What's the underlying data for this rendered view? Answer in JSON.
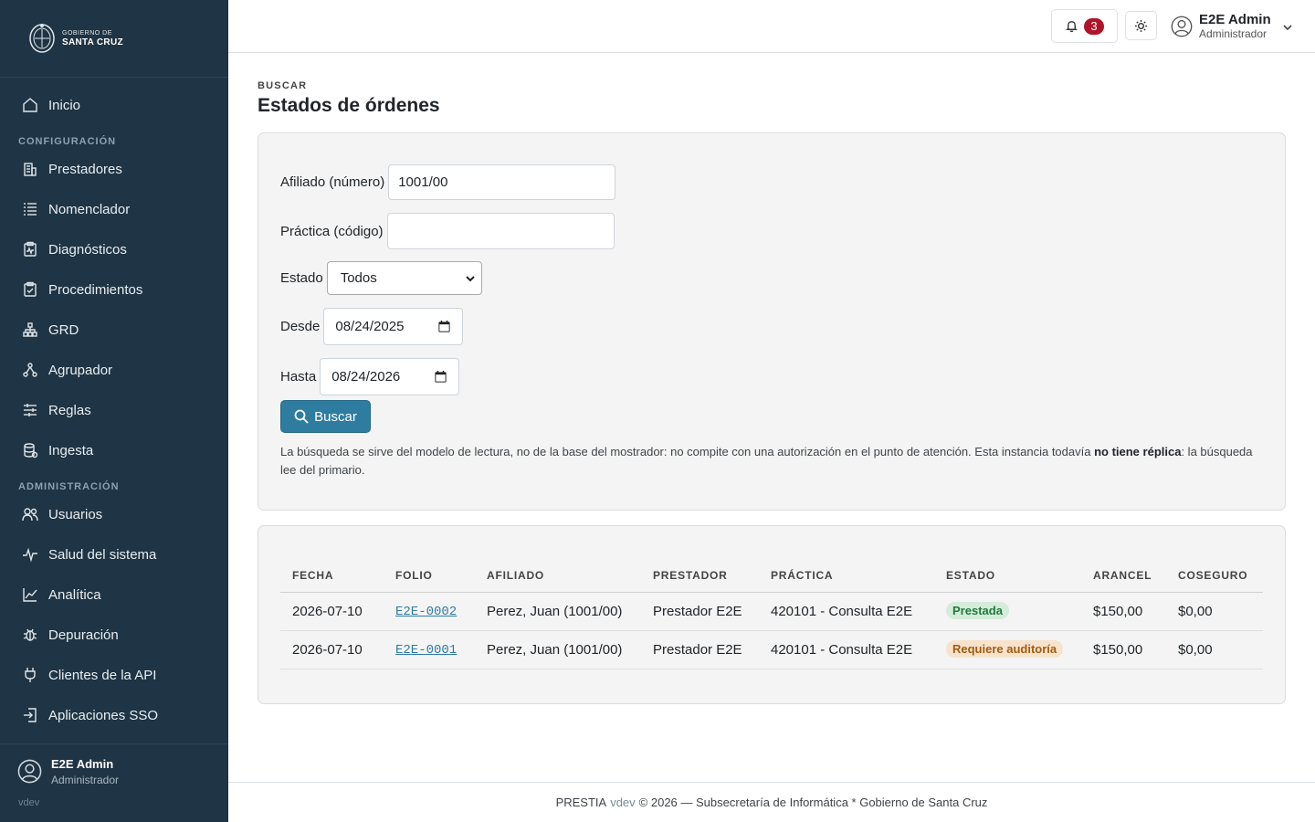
{
  "brand": {
    "line1": "GOBIERNO DE",
    "line2": "SANTA CRUZ"
  },
  "sidebar": {
    "home": "Inicio",
    "section_config": "CONFIGURACIÓN",
    "config_items": [
      {
        "label": "Prestadores",
        "icon": "building-icon"
      },
      {
        "label": "Nomenclador",
        "icon": "list-icon"
      },
      {
        "label": "Diagnósticos",
        "icon": "clipboard-pulse-icon"
      },
      {
        "label": "Procedimientos",
        "icon": "clipboard-check-icon"
      },
      {
        "label": "GRD",
        "icon": "diagram-icon"
      },
      {
        "label": "Agrupador",
        "icon": "group-icon"
      },
      {
        "label": "Reglas",
        "icon": "sliders-icon"
      },
      {
        "label": "Ingesta",
        "icon": "database-icon"
      }
    ],
    "section_admin": "ADMINISTRACIÓN",
    "admin_items": [
      {
        "label": "Usuarios",
        "icon": "users-icon"
      },
      {
        "label": "Salud del sistema",
        "icon": "activity-icon"
      },
      {
        "label": "Analítica",
        "icon": "chart-icon"
      },
      {
        "label": "Depuración",
        "icon": "bug-icon"
      },
      {
        "label": "Clientes de la API",
        "icon": "plug-icon"
      },
      {
        "label": "Aplicaciones SSO",
        "icon": "login-icon"
      }
    ],
    "user": {
      "name": "E2E Admin",
      "role": "Administrador",
      "version": "vdev"
    }
  },
  "topbar": {
    "notifications_count": "3",
    "user": {
      "name": "E2E Admin",
      "role": "Administrador"
    }
  },
  "page": {
    "eyebrow": "BUSCAR",
    "title": "Estados de órdenes"
  },
  "form": {
    "afiliado_label": "Afiliado (número)",
    "afiliado_value": "1001/00",
    "practica_label": "Práctica (código)",
    "practica_value": "",
    "estado_label": "Estado",
    "estado_value": "Todos",
    "desde_label": "Desde",
    "desde_value": "08/24/2025",
    "hasta_label": "Hasta",
    "hasta_value": "08/24/2026",
    "search_label": "Buscar",
    "help_part1": "La búsqueda se sirve del modelo de lectura, no de la base del mostrador: no compite con una autorización en el punto de atención. Esta instancia todavía ",
    "help_bold": "no tiene réplica",
    "help_part2": ": la búsqueda lee del primario."
  },
  "table": {
    "headers": [
      "FECHA",
      "FOLIO",
      "AFILIADO",
      "PRESTADOR",
      "PRÁCTICA",
      "ESTADO",
      "ARANCEL",
      "COSEGURO"
    ],
    "rows": [
      {
        "fecha": "2026-07-10",
        "folio": "E2E-0002",
        "afiliado": "Perez, Juan (1001/00)",
        "prestador": "Prestador E2E",
        "practica": "420101 - Consulta E2E",
        "estado": "Prestada",
        "arancel": "$150,00",
        "coseguro": "$0,00"
      },
      {
        "fecha": "2026-07-10",
        "folio": "E2E-0001",
        "afiliado": "Perez, Juan (1001/00)",
        "prestador": "Prestador E2E",
        "practica": "420101 - Consulta E2E",
        "estado": "Requiere auditoría",
        "arancel": "$150,00",
        "coseguro": "$0,00"
      }
    ]
  },
  "footer": {
    "app": "PRESTIA",
    "version": "vdev",
    "rest": "© 2026 — Subsecretaría de Informática * Gobierno de Santa Cruz"
  },
  "colors": {
    "sidebar": "#1f3444",
    "accent": "#2e7ca0",
    "badge": "#b0142b"
  }
}
